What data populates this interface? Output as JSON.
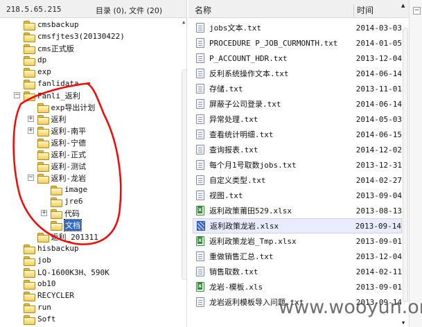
{
  "left": {
    "host": "218.5.65.215",
    "summary": "目录 (0), 文件 (20)"
  },
  "tree": [
    {
      "label": "cmsbackup",
      "level": 0
    },
    {
      "label": "cmsfjtes3(20130422)",
      "level": 0
    },
    {
      "label": "cms正式版",
      "level": 0
    },
    {
      "label": "dp",
      "level": 0
    },
    {
      "label": "exp",
      "level": 0
    },
    {
      "label": "fanlidata",
      "level": 0
    },
    {
      "label": "Fanli_返利",
      "level": 0,
      "expander": "−"
    },
    {
      "label": "exp导出计划",
      "level": 1
    },
    {
      "label": "返利",
      "level": 1,
      "expander": "+"
    },
    {
      "label": "返利-南平",
      "level": 1,
      "expander": "+"
    },
    {
      "label": "返利-宁德",
      "level": 1
    },
    {
      "label": "返利-正式",
      "level": 1
    },
    {
      "label": "返利-测试",
      "level": 1
    },
    {
      "label": "返利-龙岩",
      "level": 1,
      "expander": "−"
    },
    {
      "label": "image",
      "level": 2
    },
    {
      "label": "jre6",
      "level": 2
    },
    {
      "label": "代码",
      "level": 2,
      "expander": "+"
    },
    {
      "label": "文档",
      "level": 2,
      "selected": true
    },
    {
      "label": "返利_201311",
      "level": 1
    },
    {
      "label": "hisbackup",
      "level": 0
    },
    {
      "label": "job",
      "level": 0
    },
    {
      "label": "LQ-1600K3H、590K",
      "level": 0
    },
    {
      "label": "ob10",
      "level": 0
    },
    {
      "label": "RECYCLER",
      "level": 0
    },
    {
      "label": "run",
      "level": 0
    },
    {
      "label": "Soft",
      "level": 0
    }
  ],
  "files_header": {
    "name": "名称",
    "time": "时间"
  },
  "files": [
    {
      "name": "jobs文本.txt",
      "date": "2014-03-03",
      "type": "txt"
    },
    {
      "name": "PROCEDURE P_JOB_CURMONTH.txt",
      "date": "2014-01-05",
      "type": "txt"
    },
    {
      "name": "P_ACCOUNT_HDR.txt",
      "date": "2013-12-04",
      "type": "txt"
    },
    {
      "name": "反利系统操作文本.txt",
      "date": "2014-06-14",
      "type": "txt"
    },
    {
      "name": "存储.txt",
      "date": "2013-11-01",
      "type": "txt"
    },
    {
      "name": "屏蔽子公司登录.txt",
      "date": "2014-06-14",
      "type": "txt"
    },
    {
      "name": "异常处理.txt",
      "date": "2014-05-03",
      "type": "txt"
    },
    {
      "name": "查看统计明细.txt",
      "date": "2014-06-15",
      "type": "txt"
    },
    {
      "name": "查询报表.txt",
      "date": "2014-12-02",
      "type": "txt"
    },
    {
      "name": "每个月1号取数jobs.txt",
      "date": "2013-12-31",
      "type": "txt"
    },
    {
      "name": "自定义类型.txt",
      "date": "2014-02-27",
      "type": "txt"
    },
    {
      "name": "视图.txt",
      "date": "2013-09-04",
      "type": "txt"
    },
    {
      "name": "返利政策莆田529.xlsx",
      "date": "2013-08-13",
      "type": "xls"
    },
    {
      "name": "返利政策龙岩.xlsx",
      "date": "2013-09-14",
      "type": "xls",
      "highlighted": true
    },
    {
      "name": "返利政策龙岩_Tmp.xlsx",
      "date": "2013-09-01",
      "type": "xls"
    },
    {
      "name": "重做销售汇总.txt",
      "date": "2013-12-04",
      "type": "txt"
    },
    {
      "name": "销售取数.txt",
      "date": "2014-02-11",
      "type": "txt"
    },
    {
      "name": "龙岩-模板.xls",
      "date": "2013-09-01",
      "type": "xls"
    },
    {
      "name": "龙岩返利模板导入问题.txt",
      "date": "2013-09-14",
      "type": "txt"
    }
  ],
  "side": {
    "collapse": "−"
  },
  "watermark": "www.wooyun.org",
  "colors": {
    "selection": "#316ac5",
    "annotation": "#ff0000"
  }
}
